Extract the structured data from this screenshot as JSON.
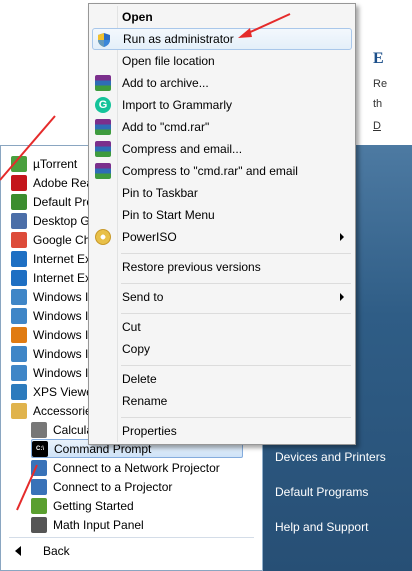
{
  "webpage": {
    "heading": "E",
    "line1": "Re",
    "line2": "th",
    "line3": "D"
  },
  "start_menu": {
    "programs": [
      {
        "label": "µTorrent",
        "icon": "utorrent-icon",
        "color": "#4aa03e"
      },
      {
        "label": "Adobe Rea",
        "icon": "adobe-reader-icon",
        "color": "#c4161c"
      },
      {
        "label": "Default Pro",
        "icon": "default-programs-icon",
        "color": "#3c8d2f"
      },
      {
        "label": "Desktop G",
        "icon": "desktop-gadget-icon",
        "color": "#4b6ea8"
      },
      {
        "label": "Google Ch",
        "icon": "google-chrome-icon",
        "color": "#dd4b39"
      },
      {
        "label": "Internet Ex",
        "icon": "internet-explorer-icon",
        "color": "#1e6fc3"
      },
      {
        "label": "Internet Ex",
        "icon": "internet-explorer-icon",
        "color": "#1e6fc3"
      },
      {
        "label": "Windows I",
        "icon": "windows-icon",
        "color": "#3f86c7"
      },
      {
        "label": "Windows I",
        "icon": "windows-icon",
        "color": "#3f86c7"
      },
      {
        "label": "Windows I",
        "icon": "windows-media-icon",
        "color": "#e07b12"
      },
      {
        "label": "Windows I",
        "icon": "windows-icon",
        "color": "#3f86c7"
      },
      {
        "label": "Windows I",
        "icon": "windows-icon",
        "color": "#3f86c7"
      },
      {
        "label": "XPS Viewe",
        "icon": "xps-viewer-icon",
        "color": "#2c7bbd"
      },
      {
        "label": "Accessorie",
        "icon": "folder-icon",
        "color": "#e0b34c"
      },
      {
        "label": "Calcula",
        "icon": "calculator-icon",
        "color": "#777777"
      },
      {
        "label": "Command Prompt",
        "icon": "cmd-icon",
        "color": "#000000"
      },
      {
        "label": "Connect to a Network Projector",
        "icon": "network-projector-icon",
        "color": "#3972b8"
      },
      {
        "label": "Connect to a Projector",
        "icon": "projector-icon",
        "color": "#3972b8"
      },
      {
        "label": "Getting Started",
        "icon": "getting-started-icon",
        "color": "#5a9f2f"
      },
      {
        "label": "Math Input Panel",
        "icon": "math-input-icon",
        "color": "#555555"
      }
    ],
    "back_label": "Back",
    "right_pane": {
      "devices": "Devices and Printers",
      "default_programs": "Default Programs",
      "help": "Help and Support"
    }
  },
  "context_menu": {
    "open": "Open",
    "run_as_admin": "Run as administrator",
    "open_location": "Open file location",
    "add_archive": "Add to archive...",
    "grammarly": "Import to Grammarly",
    "add_rar": "Add to \"cmd.rar\"",
    "compress_email": "Compress and email...",
    "compress_rar_email": "Compress to \"cmd.rar\" and email",
    "pin_taskbar": "Pin to Taskbar",
    "pin_start": "Pin to Start Menu",
    "poweriso": "PowerISO",
    "restore": "Restore previous versions",
    "send_to": "Send to",
    "cut": "Cut",
    "copy": "Copy",
    "delete": "Delete",
    "rename": "Rename",
    "properties": "Properties"
  }
}
